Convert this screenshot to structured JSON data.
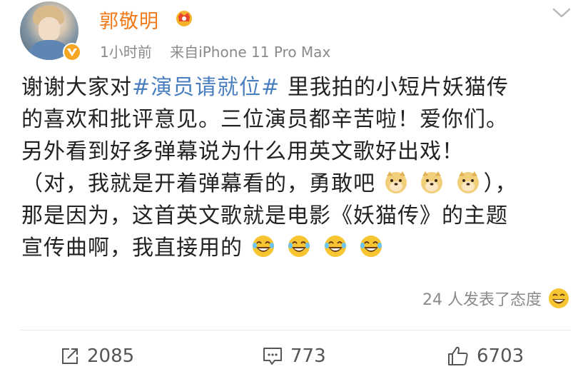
{
  "author": {
    "name": "郭敬明",
    "timestamp": "1小时前",
    "source": "来自iPhone 11 Pro Max"
  },
  "post": {
    "lines": [
      {
        "pre": "谢谢大家对",
        "hashtag": "#演员请就位#",
        "post": " 里我拍的小短片妖猫传"
      },
      {
        "text": "的喜欢和批评意见。三位演员都辛苦啦！爱你们。"
      },
      {
        "text": "另外看到好多弹幕说为什么用英文歌好出戏！"
      },
      {
        "pre": "（对，我就是开着弹幕看的，勇敢吧",
        "post": "），"
      },
      {
        "text": "那是因为，这首英文歌就是电影《妖猫传》的主题"
      },
      {
        "pre": "宣传曲啊，我直接用的"
      }
    ]
  },
  "reactions": {
    "text": "24 人发表了态度"
  },
  "actions": {
    "repost_count": "2085",
    "comment_count": "773",
    "like_count": "6703"
  },
  "colors": {
    "username": "#f07a1a",
    "hashtag": "#4a7fbf",
    "meta": "#8a8a8a"
  }
}
